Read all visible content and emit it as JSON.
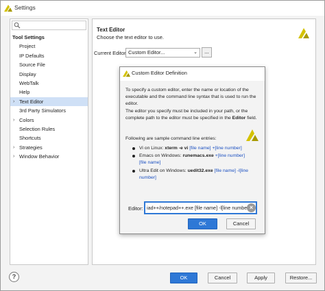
{
  "window": {
    "title": "Settings"
  },
  "search": {
    "placeholder": "",
    "value": ""
  },
  "sidebar": {
    "section_title": "Tool Settings",
    "items": [
      {
        "label": "Project",
        "expandable": false
      },
      {
        "label": "IP Defaults",
        "expandable": false
      },
      {
        "label": "Source File",
        "expandable": false
      },
      {
        "label": "Display",
        "expandable": false
      },
      {
        "label": "WebTalk",
        "expandable": false
      },
      {
        "label": "Help",
        "expandable": false
      },
      {
        "label": "Text Editor",
        "expandable": true,
        "selected": true
      },
      {
        "label": "3rd Party Simulators",
        "expandable": false
      },
      {
        "label": "Colors",
        "expandable": true
      },
      {
        "label": "Selection Rules",
        "expandable": false
      },
      {
        "label": "Shortcuts",
        "expandable": false
      },
      {
        "label": "Strategies",
        "expandable": true
      },
      {
        "label": "Window Behavior",
        "expandable": true
      }
    ]
  },
  "main": {
    "title": "Text Editor",
    "subtitle": "Choose the text editor to use.",
    "current_editor_label": "Current Editor:",
    "current_editor_value": "Custom Editor...",
    "browse_label": "..."
  },
  "dialog": {
    "title": "Custom Editor Definition",
    "para1": "To specify a custom editor, enter the name or location of the executable and the command line syntax that is used to run the editor.",
    "para2_a": "The editor you specify must be included in your path, or the complete path to the editor must be specified in the ",
    "para2_b": "Editor",
    "para2_c": " field.",
    "samples_intro": "Following are sample command line entries:",
    "samples": [
      {
        "prefix": "Vi on Linux: ",
        "cmd": "xterm -e vi",
        "args": " [file name] +[line number]"
      },
      {
        "prefix": "Emacs on Windows: ",
        "cmd": "runemacs.exe",
        "args": " +[line number] [file name]"
      },
      {
        "prefix": "Ultra Edit on Windows: ",
        "cmd": "uedit32.exe",
        "args": " [file name] -l[line number]"
      }
    ],
    "editor_label": "Editor:",
    "editor_value": "iad++/notepad++.exe [file name] -l[line number]",
    "ok_label": "OK",
    "cancel_label": "Cancel"
  },
  "footer": {
    "help_label": "?",
    "ok_label": "OK",
    "cancel_label": "Cancel",
    "apply_label": "Apply",
    "restore_label": "Restore..."
  },
  "colors": {
    "accent": "#2e78d6",
    "selection": "#cfe0f6",
    "logo": "#d4c200"
  },
  "icons": {
    "app": "vivado-logo-icon",
    "search": "search-icon",
    "clear": "clear-icon",
    "help": "help-icon"
  }
}
